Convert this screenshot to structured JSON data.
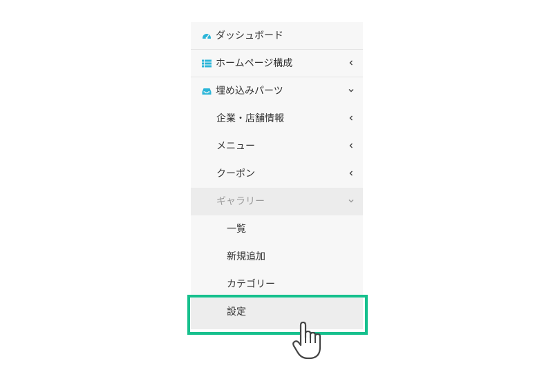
{
  "menu": {
    "dashboard": {
      "label": "ダッシュボード",
      "icon": "dashboard-icon"
    },
    "homepage": {
      "label": "ホームページ構成",
      "icon": "list-icon"
    },
    "embed": {
      "label": "埋め込みパーツ",
      "icon": "inbox-icon"
    },
    "company": {
      "label": "企業・店舗情報"
    },
    "menu_item": {
      "label": "メニュー"
    },
    "coupon": {
      "label": "クーポン"
    },
    "gallery": {
      "label": "ギャラリー",
      "children": [
        {
          "label": "一覧"
        },
        {
          "label": "新規追加"
        },
        {
          "label": "カテゴリー"
        },
        {
          "label": "設定"
        }
      ]
    }
  },
  "colors": {
    "accent_icon": "#2bb5d8",
    "highlight": "#16c08d",
    "sidebar_bg": "#f7f7f7"
  },
  "cursor": {
    "icon": "hand-pointer-icon"
  }
}
